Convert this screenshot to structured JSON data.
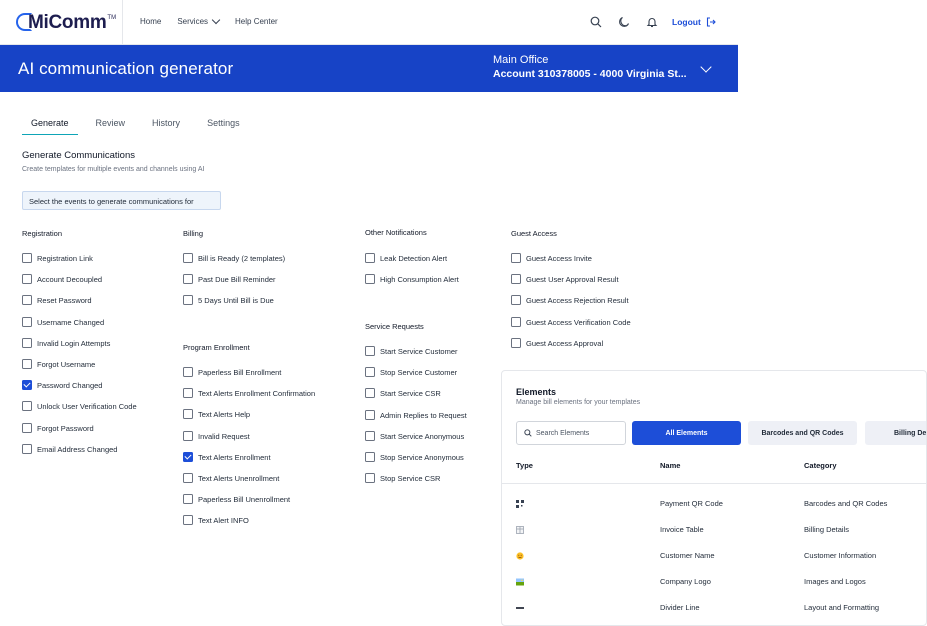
{
  "header": {
    "logo_text": "MiComm",
    "logo_tm": "TM",
    "nav": [
      {
        "label": "Home"
      },
      {
        "label": "Services"
      },
      {
        "label": "Help Center"
      }
    ],
    "logout_label": "Logout"
  },
  "banner": {
    "title": "AI communication generator",
    "account_name": "Main Office",
    "account_number": "Account 310378005 - 4000 Virginia St..."
  },
  "tabs": [
    {
      "label": "Generate"
    },
    {
      "label": "Review"
    },
    {
      "label": "History"
    },
    {
      "label": "Settings"
    }
  ],
  "generate": {
    "title": "Generate Communications",
    "subtitle": "Create templates for multiple events and channels using AI",
    "select_prompt": "Select the events to generate communications for"
  },
  "groups": {
    "registration": {
      "title": "Registration",
      "items": [
        {
          "label": "Registration Link",
          "checked": false
        },
        {
          "label": "Account Decoupled",
          "checked": false
        },
        {
          "label": "Reset Password",
          "checked": false
        },
        {
          "label": "Username Changed",
          "checked": false
        },
        {
          "label": "Invalid Login Attempts",
          "checked": false
        },
        {
          "label": "Forgot Username",
          "checked": false
        },
        {
          "label": "Password Changed",
          "checked": true
        },
        {
          "label": "Unlock User Verification Code",
          "checked": false
        },
        {
          "label": "Forgot Password",
          "checked": false
        },
        {
          "label": "Email Address Changed",
          "checked": false
        }
      ]
    },
    "billing": {
      "title": "Billing",
      "items": [
        {
          "label": "Bill is Ready (2 templates)",
          "checked": false
        },
        {
          "label": "Past Due Bill Reminder",
          "checked": false
        },
        {
          "label": "5 Days Until Bill is Due",
          "checked": false
        }
      ]
    },
    "program_enrollment": {
      "title": "Program Enrollment",
      "items": [
        {
          "label": "Paperless Bill Enrollment",
          "checked": false
        },
        {
          "label": "Text Alerts Enrollment Confirmation",
          "checked": false
        },
        {
          "label": "Text Alerts Help",
          "checked": false
        },
        {
          "label": "Invalid Request",
          "checked": false
        },
        {
          "label": "Text Alerts Enrollment",
          "checked": true
        },
        {
          "label": "Text Alerts Unenrollment",
          "checked": false
        },
        {
          "label": "Paperless Bill Unenrollment",
          "checked": false
        },
        {
          "label": "Text Alert INFO",
          "checked": false
        }
      ]
    },
    "other_notifications": {
      "title": "Other Notifications",
      "items": [
        {
          "label": "Leak Detection Alert",
          "checked": false
        },
        {
          "label": "High Consumption Alert",
          "checked": false
        }
      ]
    },
    "service_requests": {
      "title": "Service Requests",
      "items": [
        {
          "label": "Start Service Customer",
          "checked": false
        },
        {
          "label": "Stop Service Customer",
          "checked": false
        },
        {
          "label": "Start Service CSR",
          "checked": false
        },
        {
          "label": "Admin Replies to Request",
          "checked": false
        },
        {
          "label": "Start Service Anonymous",
          "checked": false
        },
        {
          "label": "Stop Service Anonymous",
          "checked": false
        },
        {
          "label": "Stop Service CSR",
          "checked": false
        }
      ]
    },
    "guest_access": {
      "title": "Guest Access",
      "items": [
        {
          "label": "Guest Access Invite",
          "checked": false
        },
        {
          "label": "Guest User Approval Result",
          "checked": false
        },
        {
          "label": "Guest Access Rejection Result",
          "checked": false
        },
        {
          "label": "Guest Access Verification Code",
          "checked": false
        },
        {
          "label": "Guest Access Approval",
          "checked": false
        }
      ]
    }
  },
  "elements": {
    "title": "Elements",
    "subtitle": "Manage bill elements for your templates",
    "search_placeholder": "Search Elements",
    "chips": [
      {
        "label": "All Elements",
        "active": true
      },
      {
        "label": "Barcodes and QR Codes",
        "active": false
      },
      {
        "label": "Billing De",
        "active": false
      }
    ],
    "columns": [
      "Type",
      "Name",
      "Category"
    ],
    "rows": [
      {
        "icon": "qr-code-icon",
        "name": "Payment QR Code",
        "category": "Barcodes and QR Codes"
      },
      {
        "icon": "table-icon",
        "name": "Invoice Table",
        "category": "Billing Details"
      },
      {
        "icon": "smiley-icon",
        "name": "Customer Name",
        "category": "Customer Information"
      },
      {
        "icon": "image-icon",
        "name": "Company Logo",
        "category": "Images and Logos"
      },
      {
        "icon": "divider-line-icon",
        "name": "Divider Line",
        "category": "Layout and Formatting"
      }
    ]
  },
  "colors": {
    "brand_blue": "#1743c6",
    "accent_blue": "#1d4ed8",
    "tab_underline": "#0ea5b7"
  }
}
